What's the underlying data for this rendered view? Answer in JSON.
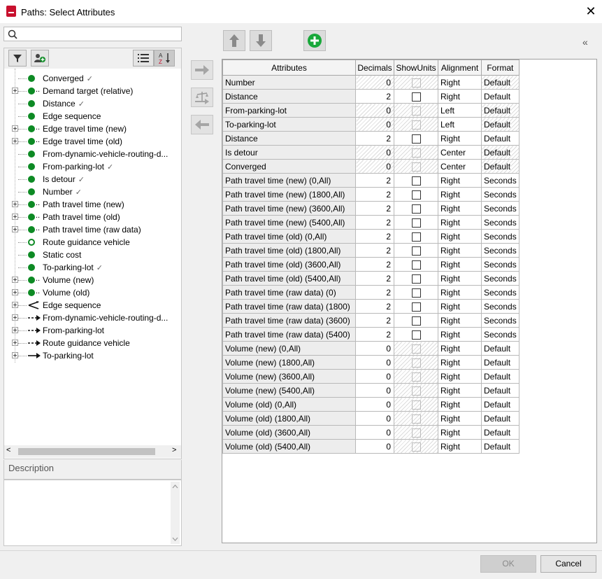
{
  "window": {
    "title": "Paths: Select Attributes",
    "close_glyph": "✕"
  },
  "search": {
    "placeholder": ""
  },
  "toolbar": {
    "filter_icon": "filter-icon",
    "user_attr_icon": "add-user-attribute-icon",
    "list_icon": "list-view-icon",
    "sort_icon": "sort-az-icon"
  },
  "tree": [
    {
      "label": "Converged",
      "check": "✓",
      "icon": "dot",
      "expand": false
    },
    {
      "label": "Demand target (relative)",
      "check": "",
      "icon": "dot-multi",
      "expand": true
    },
    {
      "label": "Distance",
      "check": "✓",
      "icon": "dot",
      "expand": false
    },
    {
      "label": "Edge sequence",
      "check": "",
      "icon": "dot",
      "expand": false
    },
    {
      "label": "Edge travel time (new)",
      "check": "",
      "icon": "dot-multi",
      "expand": true
    },
    {
      "label": "Edge travel time (old)",
      "check": "",
      "icon": "dot-multi",
      "expand": true
    },
    {
      "label": "From-dynamic-vehicle-routing-d...",
      "check": "",
      "icon": "dot",
      "expand": false
    },
    {
      "label": "From-parking-lot",
      "check": "✓",
      "icon": "dot",
      "expand": false
    },
    {
      "label": "Is detour",
      "check": "✓",
      "icon": "dot",
      "expand": false
    },
    {
      "label": "Number",
      "check": "✓",
      "icon": "dot",
      "expand": false
    },
    {
      "label": "Path travel time (new)",
      "check": "",
      "icon": "dot-multi",
      "expand": true
    },
    {
      "label": "Path travel time (old)",
      "check": "",
      "icon": "dot-multi",
      "expand": true
    },
    {
      "label": "Path travel time (raw data)",
      "check": "",
      "icon": "dot-multi",
      "expand": true
    },
    {
      "label": "Route guidance vehicle",
      "check": "",
      "icon": "hollow",
      "expand": false
    },
    {
      "label": "Static cost",
      "check": "",
      "icon": "dot",
      "expand": false
    },
    {
      "label": "To-parking-lot",
      "check": "✓",
      "icon": "dot",
      "expand": false
    },
    {
      "label": "Volume (new)",
      "check": "",
      "icon": "dot-multi",
      "expand": true
    },
    {
      "label": "Volume (old)",
      "check": "",
      "icon": "dot-multi",
      "expand": true
    },
    {
      "label": "Edge sequence",
      "check": "",
      "icon": "fork",
      "expand": true
    },
    {
      "label": "From-dynamic-vehicle-routing-d...",
      "check": "",
      "icon": "dash-arrow",
      "expand": true
    },
    {
      "label": "From-parking-lot",
      "check": "",
      "icon": "dash-arrow",
      "expand": true
    },
    {
      "label": "Route guidance vehicle",
      "check": "",
      "icon": "dash-arrow",
      "expand": true
    },
    {
      "label": "To-parking-lot",
      "check": "",
      "icon": "arrow",
      "expand": true
    }
  ],
  "description": {
    "label": "Description"
  },
  "table": {
    "headers": [
      "Attributes",
      "Decimals",
      "ShowUnits",
      "Alignment",
      "Format"
    ],
    "rows": [
      {
        "name": "Number",
        "dec": "0",
        "show": "dis",
        "align": "Right",
        "fmt": "Default",
        "hatch": true
      },
      {
        "name": "Distance",
        "dec": "2",
        "show": "on",
        "align": "Right",
        "fmt": "Default",
        "hatch": false
      },
      {
        "name": "From-parking-lot",
        "dec": "0",
        "show": "dis",
        "align": "Left",
        "fmt": "Default",
        "hatch": true
      },
      {
        "name": "To-parking-lot",
        "dec": "0",
        "show": "dis",
        "align": "Left",
        "fmt": "Default",
        "hatch": true
      },
      {
        "name": "Distance",
        "dec": "2",
        "show": "on",
        "align": "Right",
        "fmt": "Default",
        "hatch": false
      },
      {
        "name": "Is detour",
        "dec": "0",
        "show": "dis",
        "align": "Center",
        "fmt": "Default",
        "hatch": true
      },
      {
        "name": "Converged",
        "dec": "0",
        "show": "dis",
        "align": "Center",
        "fmt": "Default",
        "hatch": true
      },
      {
        "name": "Path travel time (new) (0,All)",
        "dec": "2",
        "show": "on",
        "align": "Right",
        "fmt": "Seconds",
        "hatch": false
      },
      {
        "name": "Path travel time (new) (1800,All)",
        "dec": "2",
        "show": "on",
        "align": "Right",
        "fmt": "Seconds",
        "hatch": false
      },
      {
        "name": "Path travel time (new) (3600,All)",
        "dec": "2",
        "show": "on",
        "align": "Right",
        "fmt": "Seconds",
        "hatch": false
      },
      {
        "name": "Path travel time (new) (5400,All)",
        "dec": "2",
        "show": "on",
        "align": "Right",
        "fmt": "Seconds",
        "hatch": false
      },
      {
        "name": "Path travel time (old) (0,All)",
        "dec": "2",
        "show": "on",
        "align": "Right",
        "fmt": "Seconds",
        "hatch": false
      },
      {
        "name": "Path travel time (old) (1800,All)",
        "dec": "2",
        "show": "on",
        "align": "Right",
        "fmt": "Seconds",
        "hatch": false
      },
      {
        "name": "Path travel time (old) (3600,All)",
        "dec": "2",
        "show": "on",
        "align": "Right",
        "fmt": "Seconds",
        "hatch": false
      },
      {
        "name": "Path travel time (old) (5400,All)",
        "dec": "2",
        "show": "on",
        "align": "Right",
        "fmt": "Seconds",
        "hatch": false
      },
      {
        "name": "Path travel time (raw data) (0)",
        "dec": "2",
        "show": "on",
        "align": "Right",
        "fmt": "Seconds",
        "hatch": false
      },
      {
        "name": "Path travel time (raw data) (1800)",
        "dec": "2",
        "show": "on",
        "align": "Right",
        "fmt": "Seconds",
        "hatch": false
      },
      {
        "name": "Path travel time (raw data) (3600)",
        "dec": "2",
        "show": "on",
        "align": "Right",
        "fmt": "Seconds",
        "hatch": false
      },
      {
        "name": "Path travel time (raw data) (5400)",
        "dec": "2",
        "show": "on",
        "align": "Right",
        "fmt": "Seconds",
        "hatch": false
      },
      {
        "name": "Volume (new) (0,All)",
        "dec": "0",
        "show": "dis",
        "align": "Right",
        "fmt": "Default",
        "hatch": false
      },
      {
        "name": "Volume (new) (1800,All)",
        "dec": "0",
        "show": "dis",
        "align": "Right",
        "fmt": "Default",
        "hatch": false
      },
      {
        "name": "Volume (new) (3600,All)",
        "dec": "0",
        "show": "dis",
        "align": "Right",
        "fmt": "Default",
        "hatch": false
      },
      {
        "name": "Volume (new) (5400,All)",
        "dec": "0",
        "show": "dis",
        "align": "Right",
        "fmt": "Default",
        "hatch": false
      },
      {
        "name": "Volume (old) (0,All)",
        "dec": "0",
        "show": "dis",
        "align": "Right",
        "fmt": "Default",
        "hatch": false
      },
      {
        "name": "Volume (old) (1800,All)",
        "dec": "0",
        "show": "dis",
        "align": "Right",
        "fmt": "Default",
        "hatch": false
      },
      {
        "name": "Volume (old) (3600,All)",
        "dec": "0",
        "show": "dis",
        "align": "Right",
        "fmt": "Default",
        "hatch": false
      },
      {
        "name": "Volume (old) (5400,All)",
        "dec": "0",
        "show": "dis",
        "align": "Right",
        "fmt": "Default",
        "hatch": false
      }
    ]
  },
  "buttons": {
    "ok": "OK",
    "cancel": "Cancel"
  },
  "colors": {
    "green": "#0d8a24"
  }
}
